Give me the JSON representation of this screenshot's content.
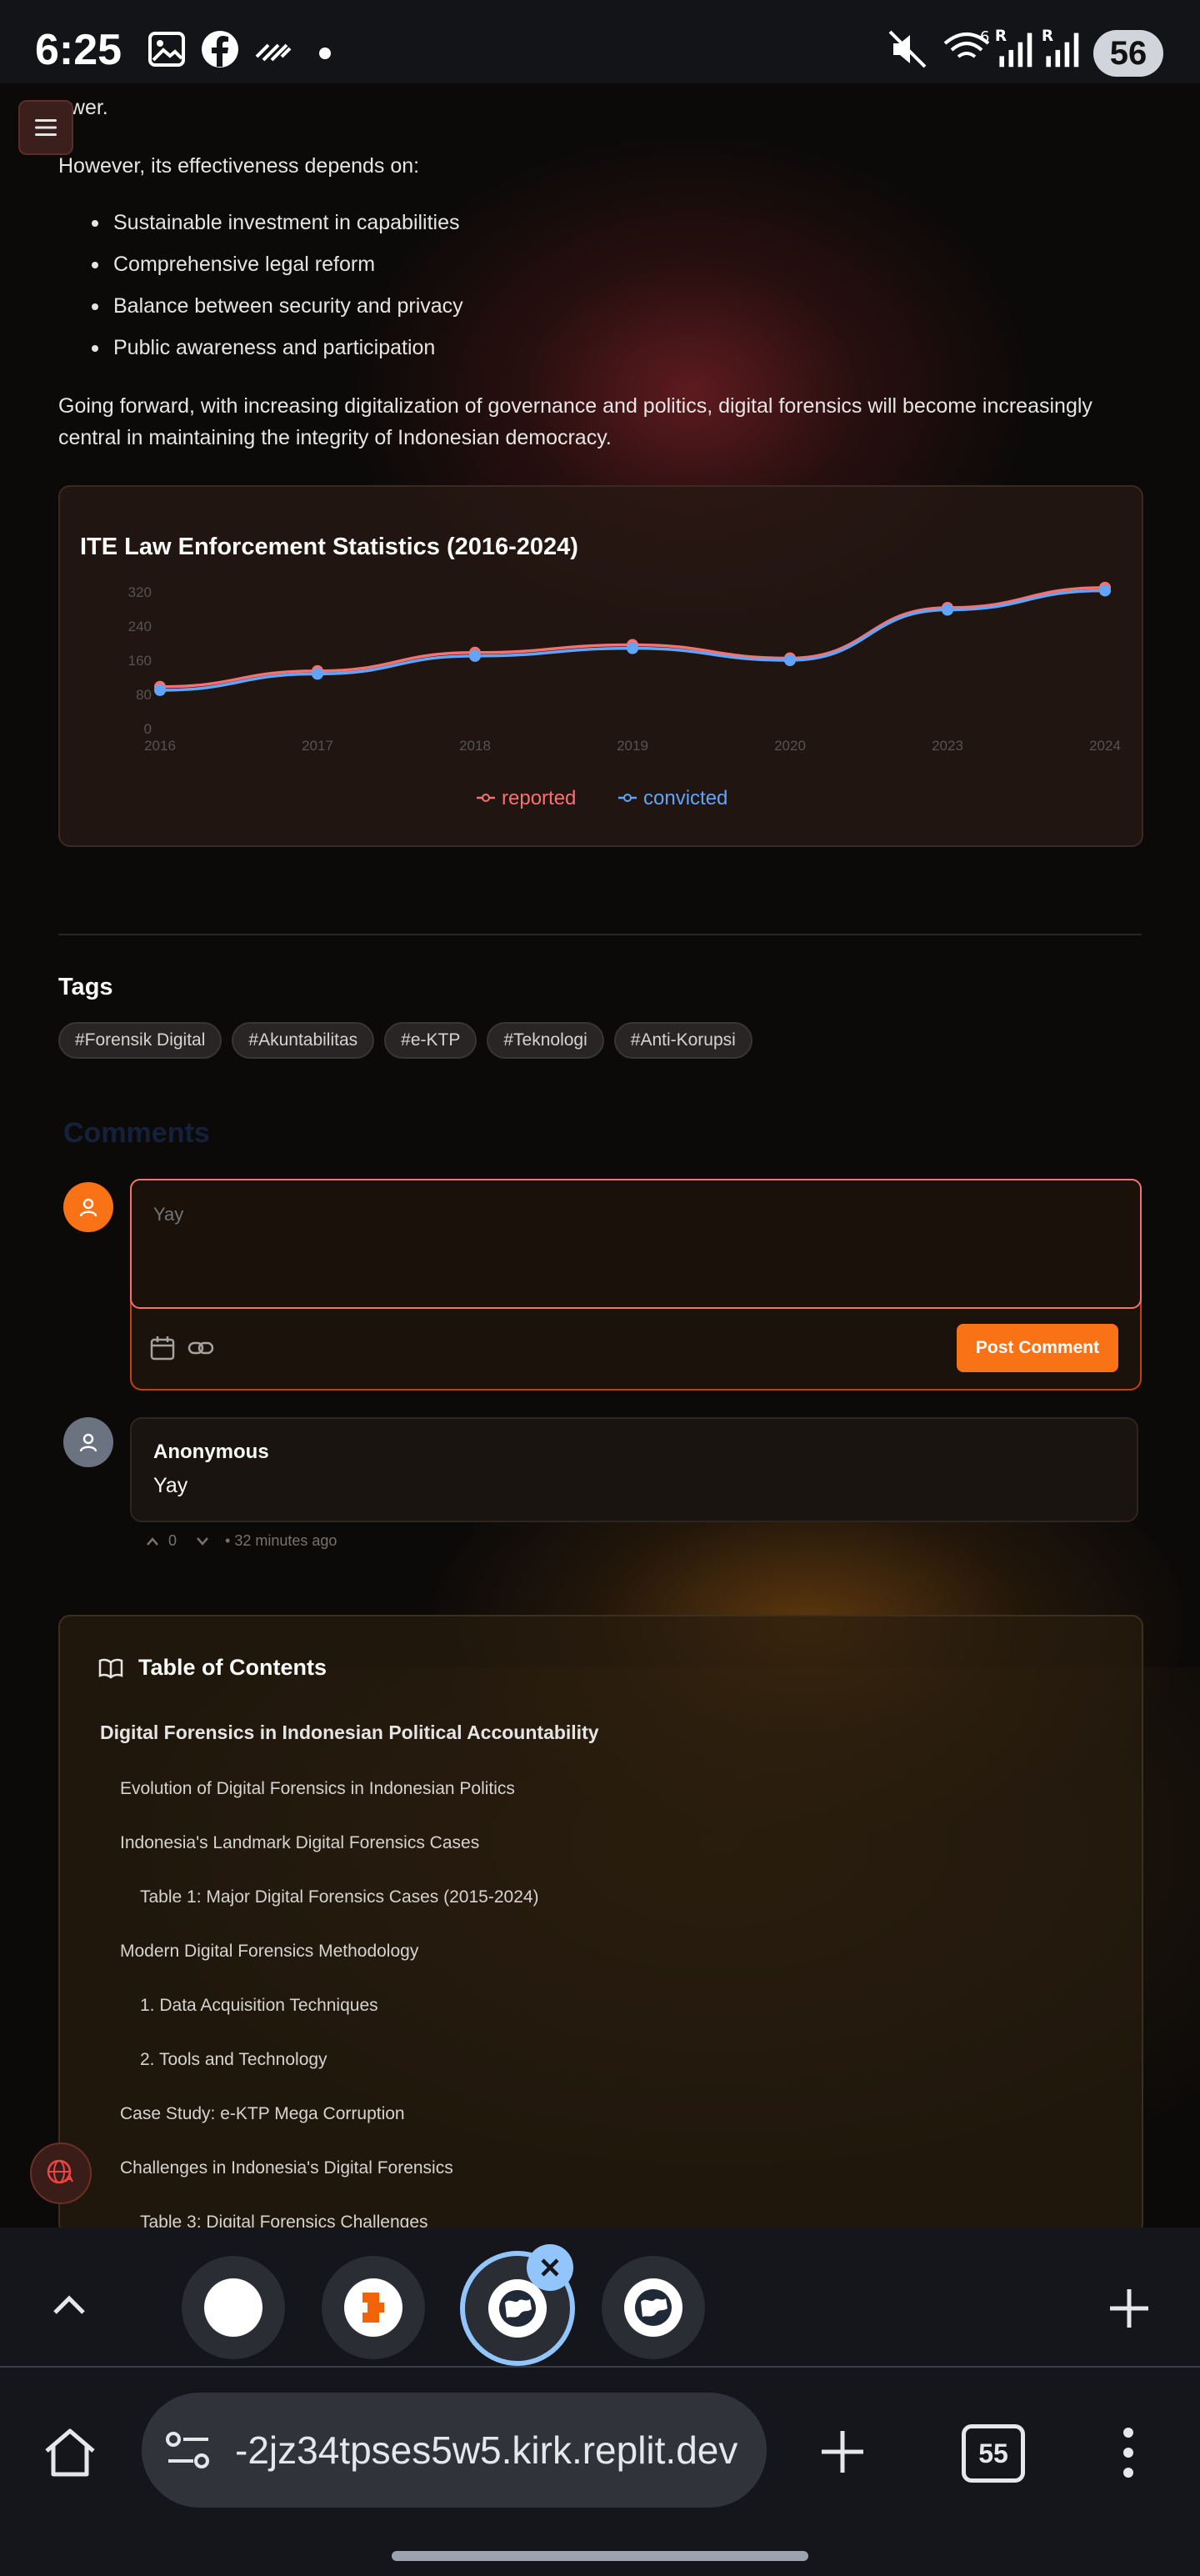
{
  "status_bar": {
    "time": "6:25",
    "battery": "56",
    "signal_label_1": "R",
    "signal_label_2": "R",
    "wifi_badge": "6"
  },
  "article": {
    "truncated_line": "ower.",
    "intro": "However, its effectiveness depends on:",
    "bullets": [
      "Sustainable investment in capabilities",
      "Comprehensive legal reform",
      "Balance between security and privacy",
      "Public awareness and participation"
    ],
    "conclusion": "Going forward, with increasing digitalization of governance and politics, digital forensics will become increasingly central in maintaining the integrity of Indonesian democracy."
  },
  "chart_data": {
    "type": "line",
    "title": "ITE Law Enforcement Statistics (2016-2024)",
    "x": [
      "2016",
      "2017",
      "2018",
      "2019",
      "2020",
      "2023",
      "2024"
    ],
    "y_ticks": [
      "0",
      "80",
      "160",
      "240",
      "320"
    ],
    "ylim": [
      0,
      320
    ],
    "series": [
      {
        "name": "reported",
        "color": "#f87171",
        "values": [
          98,
          135,
          178,
          196,
          165,
          283,
          330
        ]
      },
      {
        "name": "convicted",
        "color": "#60a5fa",
        "values": [
          90,
          128,
          170,
          188,
          160,
          278,
          323
        ]
      }
    ],
    "legend_position": "bottom"
  },
  "tags": {
    "title": "Tags",
    "items": [
      "#Forensik Digital",
      "#Akuntabilitas",
      "#e-KTP",
      "#Teknologi",
      "#Anti-Korupsi"
    ]
  },
  "comments": {
    "title": "Comments",
    "input_value": "Yay",
    "post_label": "Post Comment",
    "list": [
      {
        "author": "Anonymous",
        "text": "Yay",
        "votes": "0",
        "time": "• 32 minutes ago"
      }
    ]
  },
  "toc": {
    "title": "Table of Contents",
    "items": [
      "Digital Forensics in Indonesian Political Accountability",
      "Evolution of Digital Forensics in Indonesian Politics",
      "Indonesia's Landmark Digital Forensics Cases",
      "Table 1: Major Digital Forensics Cases (2015-2024)",
      "Modern Digital Forensics Methodology",
      "1. Data Acquisition Techniques",
      "2. Tools and Technology",
      "Case Study: e-KTP Mega Corruption",
      "Challenges in Indonesia's Digital Forensics",
      "Table 3: Digital Forensics Challenges"
    ]
  },
  "browser": {
    "url": "-2jz34tpses5w5.kirk.replit.dev",
    "tab_count": "55"
  },
  "colors": {
    "accent": "#f97316",
    "reported": "#f87171",
    "convicted": "#60a5fa",
    "background": "#0c0a09"
  }
}
